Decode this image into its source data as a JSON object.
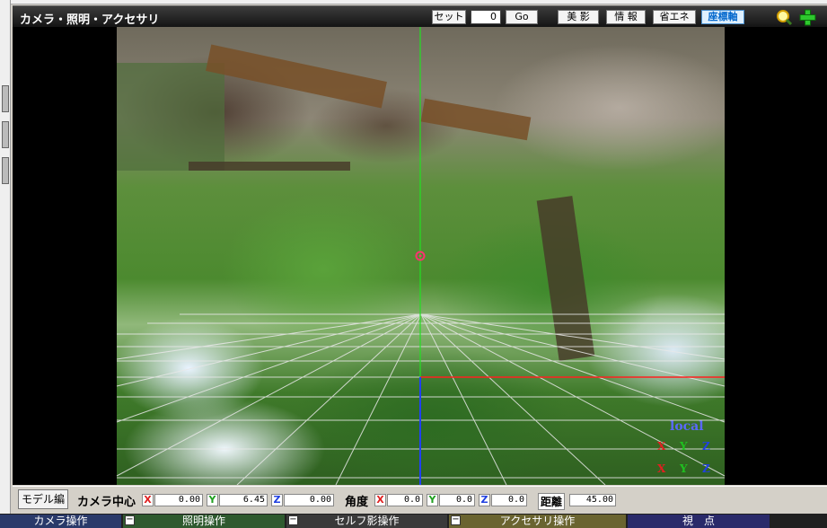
{
  "window": {
    "title": "カメラ・照明・アクセサリ"
  },
  "toolbar": {
    "set_label": "セット",
    "frame_value": "0",
    "go_label": "Go",
    "beauty_shadow_label": "美 影",
    "info_label": "情 報",
    "power_save_label": "省エネ",
    "coord_axis_label": "座標軸",
    "zoom_icon": "magnifier-icon",
    "move_icon": "plus-move-icon",
    "active_color": "#0066cc"
  },
  "viewport": {
    "local_label": "local",
    "axis_letters": {
      "x": "X",
      "y": "Y",
      "z": "Z"
    },
    "axis_colors": {
      "x": "#e02020",
      "y": "#20c020",
      "z": "#2040e0"
    }
  },
  "bottom": {
    "model_edit_label": "モデル編",
    "camera_center_label": "カメラ中心",
    "center": {
      "x_label": "X",
      "x": "0.00",
      "y_label": "Y",
      "y": "6.45",
      "z_label": "Z",
      "z": "0.00"
    },
    "angle_label": "角度",
    "angle": {
      "x_label": "X",
      "x": "0.0",
      "y_label": "Y",
      "y": "0.0",
      "z_label": "Z",
      "z": "0.0"
    },
    "distance_label": "距離",
    "distance": "45.00"
  },
  "tabs": [
    {
      "label": "カメラ操作",
      "color": "#2a3a6a"
    },
    {
      "label": "照明操作",
      "color": "#2f5a2f"
    },
    {
      "label": "セルフ影操作",
      "color": "#3a3a3a"
    },
    {
      "label": "アクセサリ操作",
      "color": "#6a6430"
    },
    {
      "label": "視　点",
      "color": "#2a2a6a"
    }
  ]
}
